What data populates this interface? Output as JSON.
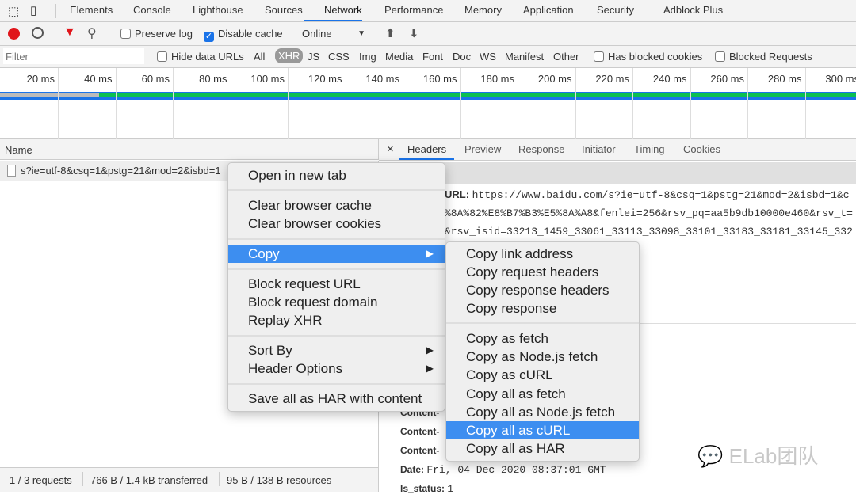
{
  "tabs": [
    "Elements",
    "Console",
    "Lighthouse",
    "Sources",
    "Network",
    "Performance",
    "Memory",
    "Application",
    "Security",
    "Adblock Plus"
  ],
  "active_tab": "Network",
  "toolbar": {
    "preserve_log": "Preserve log",
    "disable_cache": "Disable cache",
    "throttle": "Online",
    "disable_cache_checked": true,
    "preserve_log_checked": false
  },
  "filter": {
    "placeholder": "Filter",
    "hide_data_urls": "Hide data URLs",
    "types": [
      "All",
      "XHR",
      "JS",
      "CSS",
      "Img",
      "Media",
      "Font",
      "Doc",
      "WS",
      "Manifest",
      "Other"
    ],
    "active_type": "XHR",
    "blocked_cookies": "Has blocked cookies",
    "blocked_requests": "Blocked Requests"
  },
  "timeline": {
    "ticks": [
      "20 ms",
      "40 ms",
      "60 ms",
      "80 ms",
      "100 ms",
      "120 ms",
      "140 ms",
      "160 ms",
      "180 ms",
      "200 ms",
      "220 ms",
      "240 ms",
      "260 ms",
      "280 ms",
      "300 ms"
    ]
  },
  "list": {
    "header": "Name",
    "rows": [
      "s?ie=utf-8&csq=1&pstg=21&mod=2&isbd=1"
    ]
  },
  "status": {
    "requests": "1 / 3 requests",
    "transferred": "766 B / 1.4 kB transferred",
    "resources": "95 B / 138 B resources"
  },
  "detail": {
    "close": "×",
    "tabs": [
      "Headers",
      "Preview",
      "Response",
      "Initiator",
      "Timing",
      "Cookies"
    ],
    "active": "Headers",
    "url_label": "URL:",
    "url_lines": [
      "https://www.baidu.com/s?ie=utf-8&csq=1&pstg=21&mod=2&isbd=1&c",
      "%8A%82%E8%B7%B3%E5%8A%A8&fenlei=256&rsv_pq=aa5b9db10000e460&rsv_t=",
      "&rsv_isid=33213_1459_33061_33113_33098_33101_33183_33181_33145_332"
    ],
    "headers": [
      {
        "k": "Content-",
        "v": ""
      },
      {
        "k": "Content-",
        "v": ""
      },
      {
        "k": "Content-",
        "v": ""
      },
      {
        "k": "Date:",
        "v": "Fri, 04 Dec 2020 08:37:01 GMT"
      },
      {
        "k": "ls_status:",
        "v": "1"
      }
    ]
  },
  "context_menu": {
    "items": [
      "Open in new tab",
      "Clear browser cache",
      "Clear browser cookies",
      "Copy",
      "Block request URL",
      "Block request domain",
      "Replay XHR",
      "Sort By",
      "Header Options",
      "Save all as HAR with content"
    ]
  },
  "copy_submenu": {
    "items": [
      "Copy link address",
      "Copy request headers",
      "Copy response headers",
      "Copy response",
      "Copy as fetch",
      "Copy as Node.js fetch",
      "Copy as cURL",
      "Copy all as fetch",
      "Copy all as Node.js fetch",
      "Copy all as cURL",
      "Copy all as HAR"
    ],
    "highlighted": "Copy all as cURL"
  },
  "watermark": "ELab团队"
}
